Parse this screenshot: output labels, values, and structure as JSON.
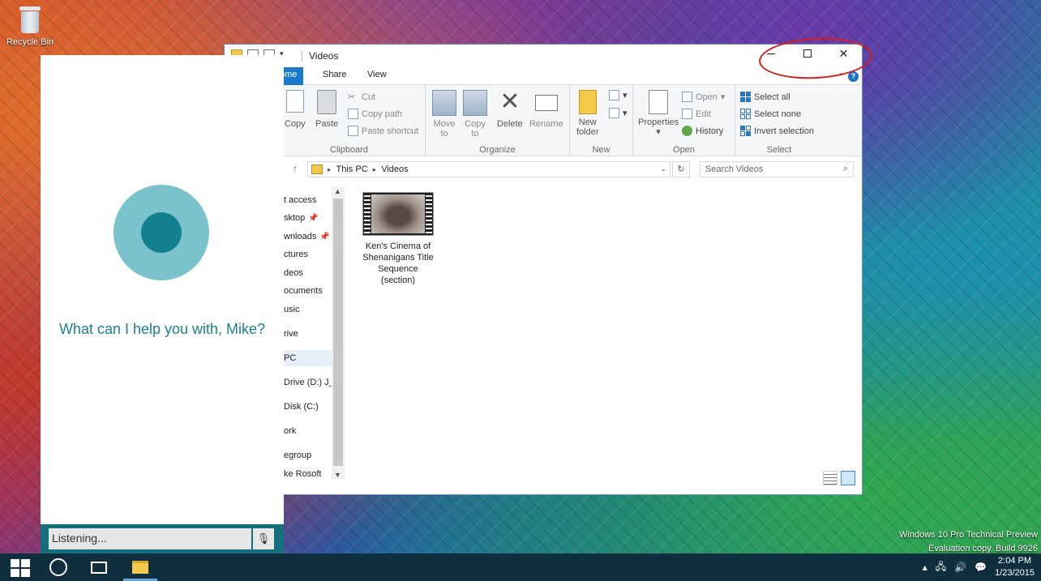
{
  "desktop": {
    "recycle_bin_label": "Recycle Bin",
    "watermark_line1": "Windows 10 Pro Technical Preview",
    "watermark_line2": "Evaluation copy. Build 9926"
  },
  "explorer": {
    "title": "Videos",
    "tabs": [
      "Home",
      "Share",
      "View"
    ],
    "tab_home_visible": "ome",
    "ribbon": {
      "clipboard": {
        "copy": "Copy",
        "paste": "Paste",
        "cut": "Cut",
        "copy_path": "Copy path",
        "paste_shortcut": "Paste shortcut",
        "label": "Clipboard"
      },
      "organize": {
        "move_to_l1": "Move",
        "move_to_l2": "to",
        "copy_to_l1": "Copy",
        "copy_to_l2": "to",
        "delete": "Delete",
        "rename": "Rename",
        "label": "Organize"
      },
      "new": {
        "new_folder_l1": "New",
        "new_folder_l2": "folder",
        "label": "New"
      },
      "open": {
        "properties": "Properties",
        "open": "Open",
        "edit": "Edit",
        "history": "History",
        "label": "Open"
      },
      "select": {
        "select_all": "Select all",
        "select_none": "Select none",
        "invert_selection": "Invert selection",
        "label": "Select"
      }
    },
    "address": {
      "crumbs": [
        "This PC",
        "Videos"
      ]
    },
    "search_placeholder": "Search Videos",
    "nav": {
      "quick_access": "t access",
      "desktop": "sktop",
      "downloads": "wnloads",
      "pictures": "ctures",
      "videos": "deos",
      "documents": "ocuments",
      "music": "usic",
      "onedrive": "rive",
      "this_pc": "PC",
      "dvd_drive": "Drive (D:) J_C",
      "local_disk": "Disk (C:)",
      "network": "ork",
      "homegroup": "egroup",
      "user": "ke Rosoft"
    },
    "files": [
      {
        "name_l1": "Ken's Cinema of",
        "name_l2": "Shenanigans Title",
        "name_l3": "Sequence",
        "name_l4": "(section)"
      }
    ]
  },
  "cortana": {
    "prompt": "What can I help you with, Mike?",
    "input_value": "Listening..."
  },
  "taskbar": {
    "time": "2:04 PM",
    "date": "1/23/2015"
  },
  "colors": {
    "cortana_accent": "#15707d",
    "orb_outer": "#7bc3cc",
    "orb_inner": "#13808f",
    "annotation_red": "#d41f1f",
    "ribbon_tab_blue": "#1979ca"
  }
}
